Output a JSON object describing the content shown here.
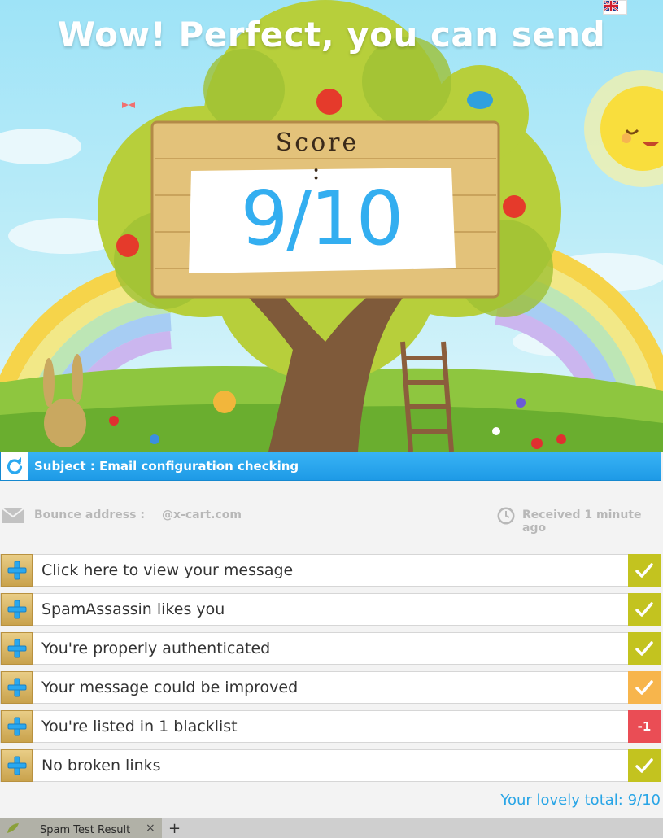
{
  "hero": {
    "headline": "Wow! Perfect, you can send",
    "score_label": "Score :",
    "score_value": "9/10"
  },
  "subject": {
    "text": "Subject : Email configuration checking"
  },
  "meta": {
    "bounce_label": "Bounce address :",
    "bounce_value": "@x-cart.com",
    "received": "Received 1 minute ago"
  },
  "results": [
    {
      "label": "Click here to view your message",
      "status": "pass",
      "badge": "",
      "color": "#c3c31f"
    },
    {
      "label": "SpamAssassin likes you",
      "status": "pass",
      "badge": "",
      "color": "#c3c31f"
    },
    {
      "label": "You're properly authenticated",
      "status": "pass",
      "badge": "",
      "color": "#c3c31f"
    },
    {
      "label": "Your message could be improved",
      "status": "warn",
      "badge": "",
      "color": "#f7b54c"
    },
    {
      "label": "You're listed in 1 blacklist",
      "status": "fail",
      "badge": "-1",
      "color": "#ea4d55"
    },
    {
      "label": "No broken links",
      "status": "pass",
      "badge": "",
      "color": "#c3c31f"
    }
  ],
  "total": "Your lovely total: 9/10",
  "tabbar": {
    "tab_label": "Spam Test Result",
    "close": "×",
    "new_tab": "+"
  },
  "colors": {
    "accent": "#29a5e6",
    "subject_bar": "#2aa8f0"
  }
}
